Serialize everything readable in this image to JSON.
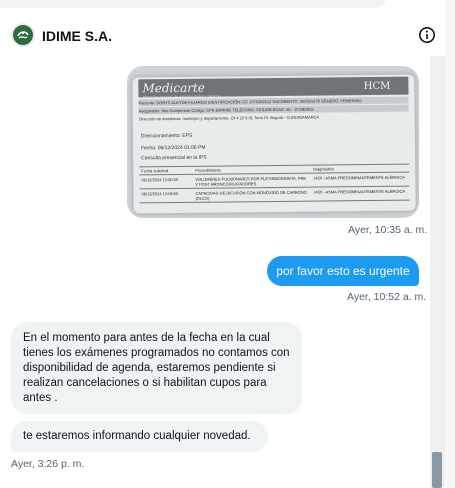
{
  "header": {
    "name": "IDIME S.A.",
    "avatar_icon": "idime-logo-icon",
    "info_icon": "info-icon"
  },
  "messages": [
    {
      "type": "image",
      "direction": "incoming",
      "document": {
        "logo": "Medicarte",
        "logo_sub": "Atención integral de enfermedades crónicas",
        "hcm": "HCM",
        "row_patient": "Paciente: DORYS ALEYDE FAJARDO     IDENTIFICACIÓN: CC 1075262512     NACIMIENTO: 26/05/1978     GÉNERO: FEMENINO",
        "row_insurer": "Asegurador: Sas Compensar     Código: CPS 6004082     TELÉFONO: 3101608     EDAD: 46 - 10 MESES",
        "row_address": "Dirección de residencia, municipio y departamento: Cll 4 23 6 91 Torre Pt. Bogotá - CUNDINAMARCA",
        "direction": "Direccionamiento: EPS",
        "date": "Fecha:  06/12/2024 01:06 PM",
        "consult": "Consulta presencial en la IPS",
        "col_date": "Fecha solicitud",
        "col_procedure": "Procedimiento",
        "col_diagnosis": "Diagnóstico",
        "rows": [
          {
            "date": "06/12/2024 13:00:50",
            "procedure": "VOLÚMENES PULMONARES POR PLETISMOGRAFÍA, PRE Y POST BRONCODILATADORES",
            "diagnosis": "J450 - ASMA PREDOMINANTEMENTE ALÉRGICA"
          },
          {
            "date": "06/12/2024 13:08:50",
            "procedure": "CAPACIDAD DE DIFUSIÓN CON MONÓXIDO DE CARBONO (DLCO)",
            "diagnosis": "J450 - ASMA PREDOMINANTEMENTE ALÉRGICA"
          }
        ]
      },
      "timestamp": "Ayer, 10:35 a. m."
    },
    {
      "type": "text",
      "direction": "outgoing",
      "text": "por favor esto es urgente",
      "timestamp": "Ayer, 10:52 a. m."
    },
    {
      "type": "text",
      "direction": "incoming",
      "text": "En  el momento para antes de la fecha en  la cual tienes los  exámenes programados no  contamos con disponibilidad  de agenda, estaremos pendiente si realizan cancelaciones o si  habilitan cupos para antes ."
    },
    {
      "type": "text",
      "direction": "incoming",
      "text": "te estaremos  informando cualquier novedad.",
      "timestamp": "Ayer, 3:26 p. m."
    }
  ],
  "colors": {
    "outgoing_bubble": "#1d9bf0",
    "incoming_bubble": "#eff3f4",
    "timestamp": "#536471",
    "text": "#0f1419"
  }
}
